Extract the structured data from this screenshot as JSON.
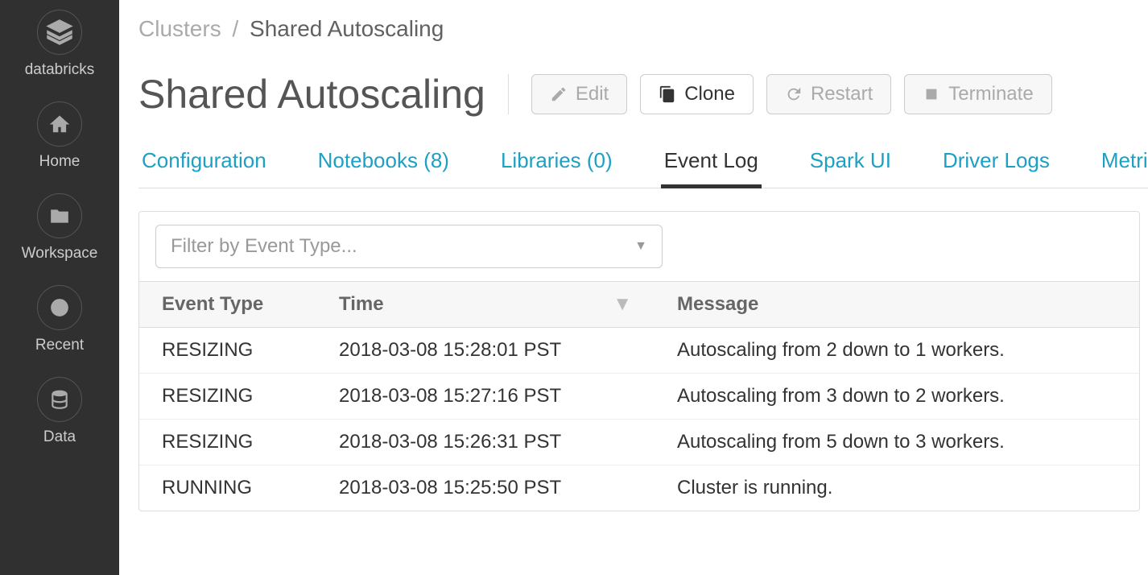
{
  "sidebar": {
    "brand": "databricks",
    "items": [
      {
        "icon": "home-icon",
        "label": "Home"
      },
      {
        "icon": "folder-icon",
        "label": "Workspace"
      },
      {
        "icon": "clock-icon",
        "label": "Recent"
      },
      {
        "icon": "database-icon",
        "label": "Data"
      }
    ]
  },
  "breadcrumbs": {
    "parent": "Clusters",
    "sep": "/",
    "current": "Shared Autoscaling"
  },
  "page_title": "Shared Autoscaling",
  "actions": {
    "edit": "Edit",
    "clone": "Clone",
    "restart": "Restart",
    "terminate": "Terminate"
  },
  "tabs": [
    {
      "label": "Configuration",
      "active": false
    },
    {
      "label": "Notebooks (8)",
      "active": false
    },
    {
      "label": "Libraries (0)",
      "active": false
    },
    {
      "label": "Event Log",
      "active": true
    },
    {
      "label": "Spark UI",
      "active": false
    },
    {
      "label": "Driver Logs",
      "active": false
    },
    {
      "label": "Metrics",
      "active": false
    }
  ],
  "filter": {
    "placeholder": "Filter by Event Type..."
  },
  "table": {
    "headers": {
      "event_type": "Event Type",
      "time": "Time",
      "message": "Message"
    },
    "rows": [
      {
        "event_type": "RESIZING",
        "time": "2018-03-08 15:28:01 PST",
        "message": "Autoscaling from 2 down to 1 workers."
      },
      {
        "event_type": "RESIZING",
        "time": "2018-03-08 15:27:16 PST",
        "message": "Autoscaling from 3 down to 2 workers."
      },
      {
        "event_type": "RESIZING",
        "time": "2018-03-08 15:26:31 PST",
        "message": "Autoscaling from 5 down to 3 workers."
      },
      {
        "event_type": "RUNNING",
        "time": "2018-03-08 15:25:50 PST",
        "message": "Cluster is running."
      }
    ]
  }
}
